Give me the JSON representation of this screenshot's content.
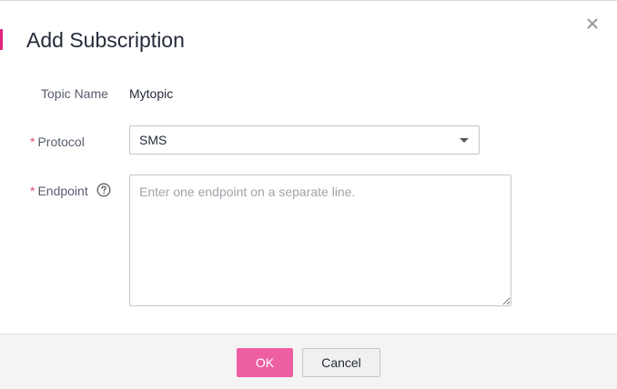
{
  "dialog": {
    "title": "Add Subscription",
    "close_icon": "close-icon",
    "accent_color": "#e0267a"
  },
  "form": {
    "topic_name": {
      "label": "Topic Name",
      "value": "Mytopic"
    },
    "protocol": {
      "required_mark": "*",
      "label": "Protocol",
      "selected": "SMS",
      "icon": "chevron-down-icon"
    },
    "endpoint": {
      "required_mark": "*",
      "label": "Endpoint",
      "help_icon": "question-circle-icon",
      "placeholder": "Enter one endpoint on a separate line.",
      "value": ""
    }
  },
  "footer": {
    "ok_label": "OK",
    "cancel_label": "Cancel",
    "ok_color": "#ee5fa2"
  }
}
